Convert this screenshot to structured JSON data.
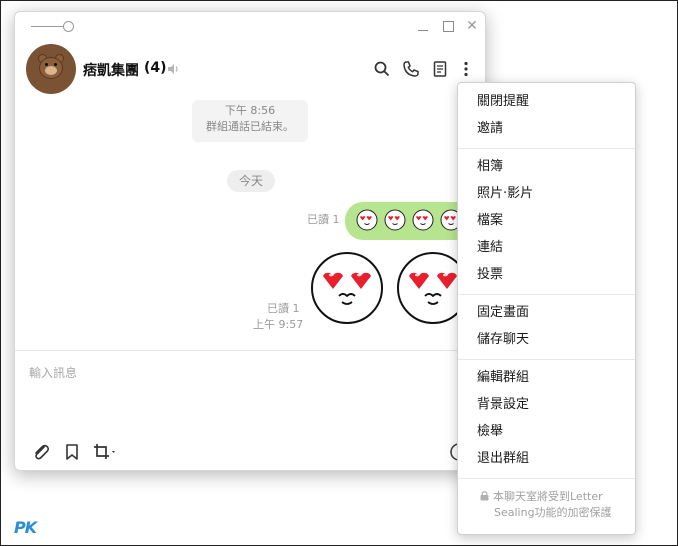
{
  "header": {
    "chat_name": "痞凱集團",
    "member_count": "(4)"
  },
  "messages": {
    "system_time": "下午 8:56",
    "system_text": "群組通話已結束。",
    "date_label": "今天",
    "read_receipt_1": "已讀 1",
    "read_receipt_2": "已讀 1",
    "time_2": "上午 9:57",
    "bubble_emoji_count": 4
  },
  "input": {
    "placeholder": "輸入訊息"
  },
  "menu": {
    "group1": [
      "關閉提醒",
      "邀請"
    ],
    "group2": [
      "相簿",
      "照片‧影片",
      "檔案",
      "連結",
      "投票"
    ],
    "group3": [
      "固定畫面",
      "儲存聊天"
    ],
    "group4": [
      "編輯群組",
      "背景設定",
      "檢舉",
      "退出群組"
    ],
    "footer_line1": "本聊天室將受到Letter",
    "footer_line2": "Sealing功能的加密保護"
  },
  "watermark": "PK",
  "colors": {
    "bubble_green": "#b7e58f",
    "heart_red": "#e8202e",
    "avatar_brown": "#7a5234"
  },
  "icons": [
    "speaker-icon",
    "search-icon",
    "phone-icon",
    "notes-icon",
    "more-vertical-icon",
    "paperclip-icon",
    "bookmark-icon",
    "crop-icon",
    "emoji-icon",
    "lock-icon"
  ]
}
